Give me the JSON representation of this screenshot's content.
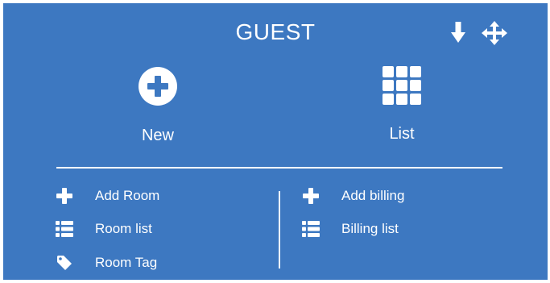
{
  "header": {
    "title": "GUEST",
    "icons": [
      "download-icon",
      "move-icon"
    ]
  },
  "actions": {
    "new": {
      "label": "New",
      "icon": "plus-circle-icon"
    },
    "list": {
      "label": "List",
      "icon": "grid-icon"
    }
  },
  "menu": {
    "left": [
      {
        "label": "Add Room",
        "icon": "plus-icon"
      },
      {
        "label": "Room list",
        "icon": "list-icon"
      },
      {
        "label": "Room Tag",
        "icon": "tag-icon"
      }
    ],
    "right": [
      {
        "label": "Add billing",
        "icon": "plus-icon"
      },
      {
        "label": "Billing list",
        "icon": "list-icon"
      }
    ]
  },
  "colors": {
    "background": "#3d78c1",
    "foreground": "#ffffff"
  }
}
